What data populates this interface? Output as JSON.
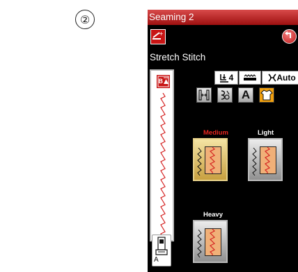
{
  "step_marker": "②",
  "screen": {
    "title": "Seaming 2",
    "stitch_name": "Stretch Stitch",
    "settings": [
      {
        "icon": "presser-foot-pressure-icon",
        "value": "4"
      },
      {
        "icon": "feed-dog-icon",
        "value": ""
      },
      {
        "icon": "thread-tension-icon",
        "value": "Auto"
      }
    ],
    "tools": [
      {
        "icon": "stitch-width-length-icon",
        "active": false
      },
      {
        "icon": "custom-stitch-icon",
        "active": false
      },
      {
        "icon": "letter-a-icon",
        "label": "A",
        "active": false
      },
      {
        "icon": "garment-icon",
        "active": true
      }
    ],
    "fabric_options": [
      {
        "label": "Medium",
        "selected": true,
        "label_color": "#e8261f"
      },
      {
        "label": "Light",
        "selected": false,
        "label_color": "#ffffff"
      },
      {
        "label": "Heavy",
        "selected": false,
        "label_color": "#ffffff"
      }
    ],
    "foot_letter": "A",
    "accent": "#c81414"
  }
}
